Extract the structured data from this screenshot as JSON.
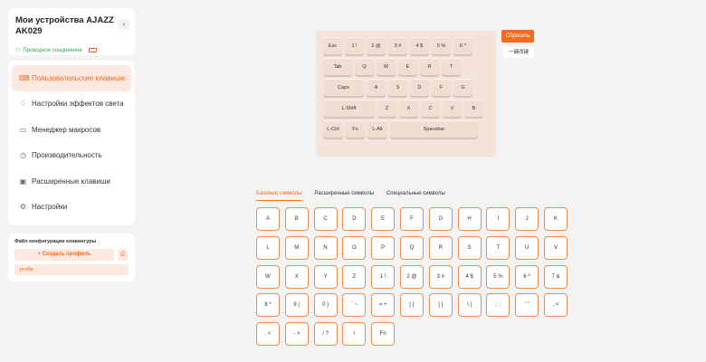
{
  "device": {
    "title": "Мои устройства AJAZZ AK029",
    "connection": "Проводное соединение"
  },
  "menu": [
    {
      "label": "Пользовательские клавиши",
      "icon": "keyboard-icon",
      "glyph": "⌨",
      "active": true
    },
    {
      "label": "Настройки эффектов света",
      "icon": "light-bulb-icon",
      "glyph": "♢",
      "active": false
    },
    {
      "label": "Менеджер макросов",
      "icon": "macro-icon",
      "glyph": "▭",
      "active": false
    },
    {
      "label": "Производительность",
      "icon": "performance-icon",
      "glyph": "◷",
      "active": false
    },
    {
      "label": "Расширенные клавиши",
      "icon": "advanced-keys-icon",
      "glyph": "▣",
      "active": false
    },
    {
      "label": "Настройки",
      "icon": "gear-icon",
      "glyph": "⚙",
      "active": false
    }
  ],
  "config": {
    "title": "Файл конфигурации клавиатуры",
    "create_label": "+ Создать профиль",
    "profile_name": "profile"
  },
  "keyboard": {
    "rows": [
      [
        {
          "label": "Esc"
        },
        {
          "label": "1 !"
        },
        {
          "label": "2 @"
        },
        {
          "label": "3 #"
        },
        {
          "label": "4 $"
        },
        {
          "label": "5 %"
        },
        {
          "label": "6 ^"
        }
      ],
      [
        {
          "label": "Tab",
          "w": "tab"
        },
        {
          "label": "Q"
        },
        {
          "label": "W"
        },
        {
          "label": "E"
        },
        {
          "label": "R"
        },
        {
          "label": "T"
        }
      ],
      [
        {
          "label": "Caps",
          "w": "caps"
        },
        {
          "label": "A"
        },
        {
          "label": "S"
        },
        {
          "label": "D"
        },
        {
          "label": "F"
        },
        {
          "label": "G"
        }
      ],
      [
        {
          "label": "L-Shift",
          "w": "lshift"
        },
        {
          "label": "Z"
        },
        {
          "label": "X"
        },
        {
          "label": "C"
        },
        {
          "label": "V"
        },
        {
          "label": "B"
        }
      ],
      [
        {
          "label": "L-Ctrl",
          "w": "ctrl"
        },
        {
          "label": "Fn",
          "w": "fn"
        },
        {
          "label": "L-Alt",
          "w": "lalt"
        },
        {
          "label": "Spacebar",
          "w": "spacebar"
        }
      ]
    ]
  },
  "actions": {
    "reset_label": "Сбросить",
    "restore_label": "一键改键"
  },
  "tabs": [
    {
      "label": "Базовые символы",
      "active": true
    },
    {
      "label": "Расширенные символы",
      "active": false
    },
    {
      "label": "Специальные символы",
      "active": false
    }
  ],
  "key_grid": [
    "A",
    "B",
    "C",
    "D",
    "E",
    "F",
    "G",
    "H",
    "I",
    "J",
    "K",
    "L",
    "M",
    "N",
    "O",
    "P",
    "Q",
    "R",
    "S",
    "T",
    "U",
    "V",
    "W",
    "X",
    "Y",
    "Z",
    "1 !",
    "2 @",
    "3 #",
    "4 $",
    "5 %",
    "6 ^",
    "7 &",
    "8 *",
    "9 (",
    "0 )",
    "` ~",
    "= +",
    "[ {",
    "] }",
    "\\ |",
    "; :",
    "' \"",
    ", <",
    ". <",
    "- >",
    "/ ?",
    "\\",
    "Fn"
  ]
}
